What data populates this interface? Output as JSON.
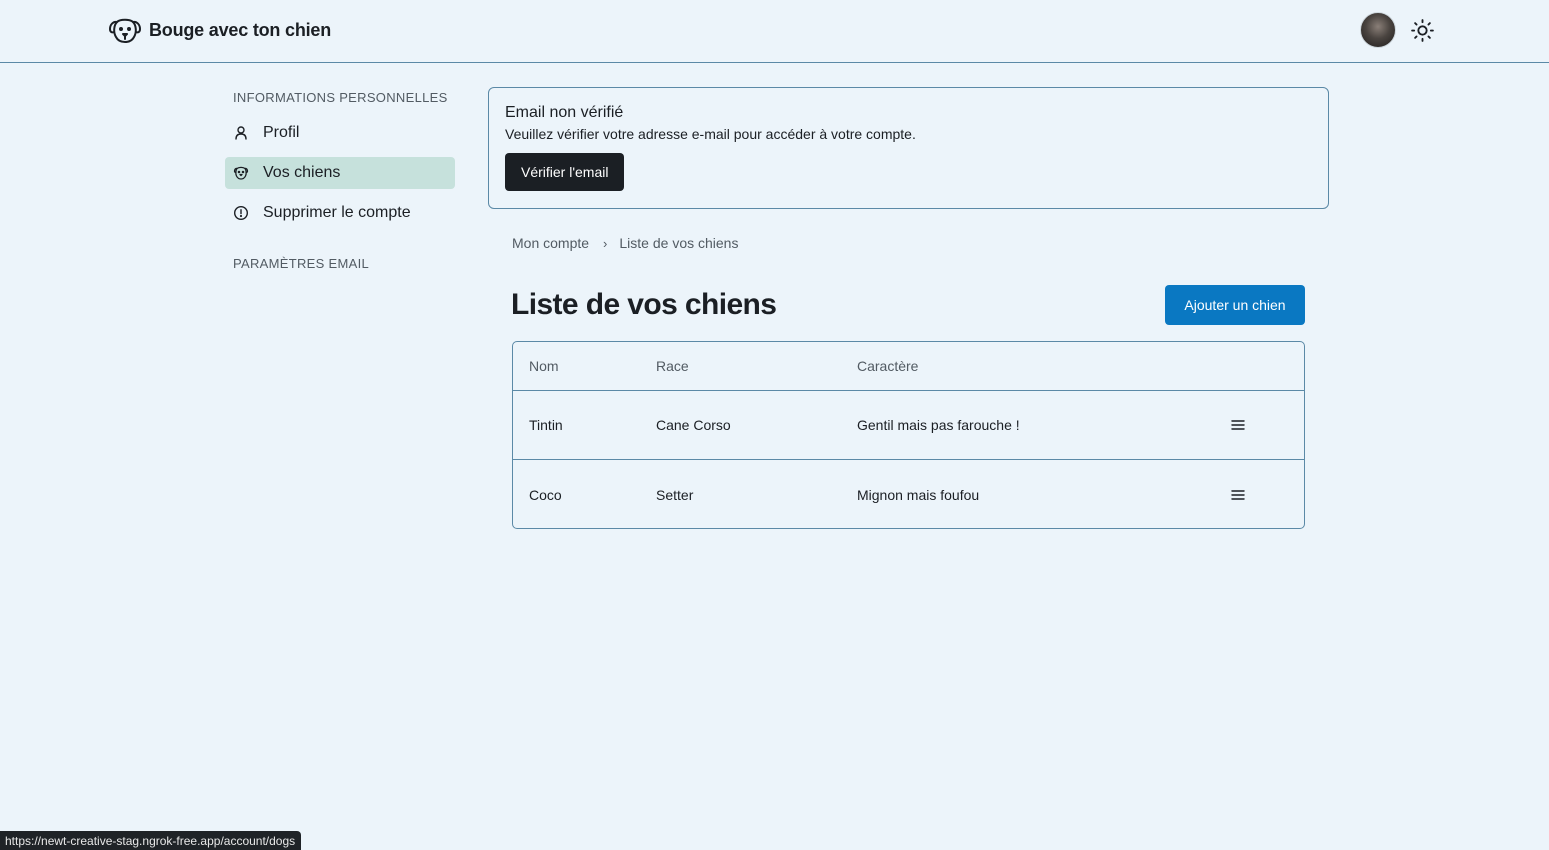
{
  "header": {
    "brand_name": "Bouge avec ton chien",
    "logo_icon": "dog-face-icon",
    "avatar_icon": "user-avatar",
    "theme_icon": "sun-icon"
  },
  "sidebar": {
    "section_personal": "INFORMATIONS PERSONNELLES",
    "items": [
      {
        "label": "Profil",
        "icon": "user-icon",
        "active": false
      },
      {
        "label": "Vos chiens",
        "icon": "dog-icon",
        "active": true
      },
      {
        "label": "Supprimer le compte",
        "icon": "alert-circle-icon",
        "active": false
      }
    ],
    "section_email": "PARAMÈTRES EMAIL"
  },
  "alert": {
    "title": "Email non vérifié",
    "text": "Veuillez vérifier votre adresse e-mail pour accéder à votre compte.",
    "button_label": "Vérifier l'email"
  },
  "breadcrumb": {
    "items": [
      "Mon compte",
      "Liste de vos chiens"
    ],
    "separator": "›"
  },
  "main": {
    "title": "Liste de vos chiens",
    "add_button_label": "Ajouter un chien"
  },
  "table": {
    "headers": [
      "Nom",
      "Race",
      "Caractère"
    ],
    "rows": [
      {
        "nom": "Tintin",
        "race": "Cane Corso",
        "caractere": "Gentil mais pas farouche !"
      },
      {
        "nom": "Coco",
        "race": "Setter",
        "caractere": "Mignon mais foufou"
      }
    ],
    "row_menu_icon": "hamburger-menu-icon"
  },
  "status_bar": {
    "url": "https://newt-creative-stag.ngrok-free.app/account/dogs"
  },
  "colors": {
    "background": "#ecf4fa",
    "border": "#5b89a6",
    "active_item": "#c6e1dc",
    "primary_button": "#0a78c2",
    "dark_button": "#1b1f24"
  }
}
